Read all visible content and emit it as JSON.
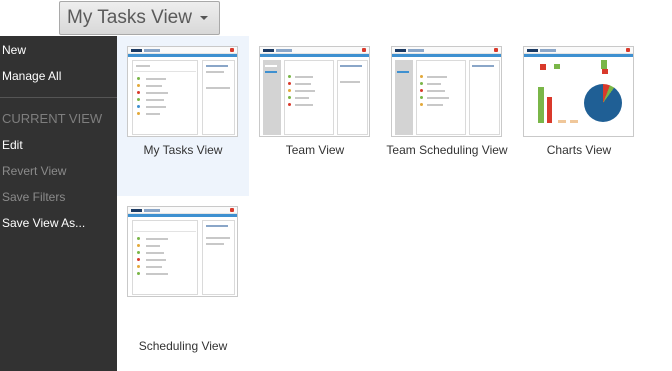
{
  "header": {
    "view_selector_label": "My Tasks View",
    "caret_icon": "caret-down-icon"
  },
  "sidebar": {
    "new_label": "New",
    "manage_all_label": "Manage All",
    "section_label": "CURRENT VIEW",
    "edit_label": "Edit",
    "revert_view_label": "Revert View",
    "save_filters_label": "Save Filters",
    "save_view_as_label": "Save View As..."
  },
  "views": [
    {
      "label": "My Tasks View",
      "selected": true
    },
    {
      "label": "Team View",
      "selected": false
    },
    {
      "label": "Team Scheduling View",
      "selected": false
    },
    {
      "label": "Charts View",
      "selected": false
    },
    {
      "label": "Scheduling View",
      "selected": false
    }
  ],
  "colors": {
    "sidebar_bg": "#323232",
    "selected_tile_bg": "#eef4fc",
    "accent": "#3e90d0",
    "brand": "#1b3a63"
  }
}
